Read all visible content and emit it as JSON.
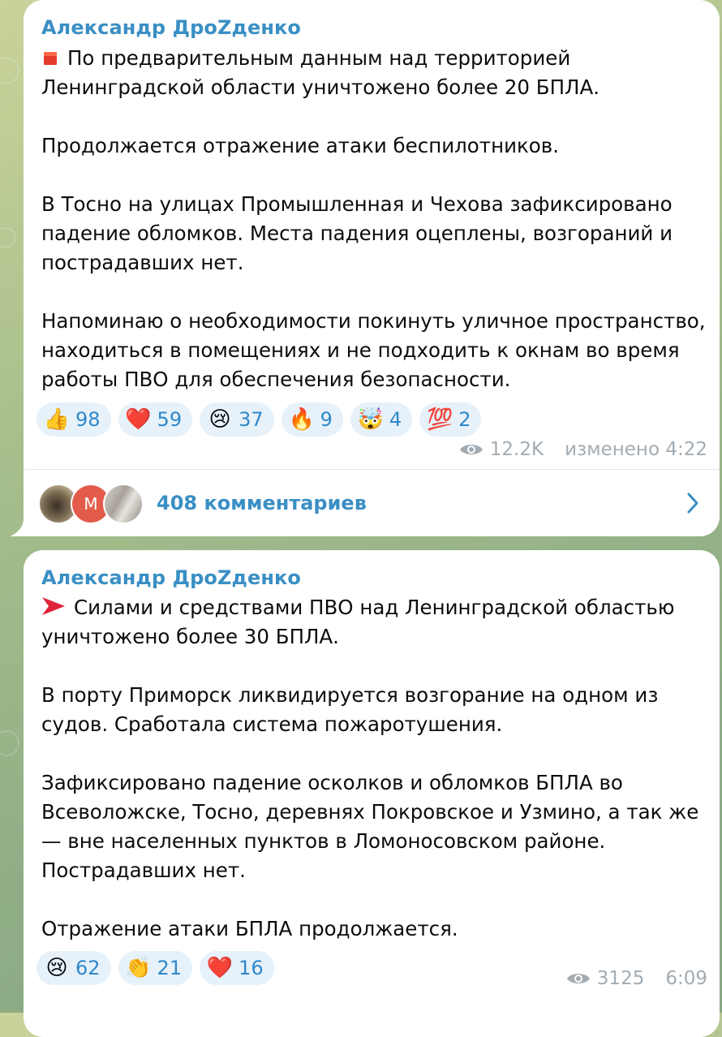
{
  "colors": {
    "link": "#3a8fc4",
    "reaction_bg": "#e6f1fa",
    "reaction_count": "#2f88c9",
    "meta": "#a3acb3",
    "text": "#0c0c0c"
  },
  "messages": [
    {
      "author": "Александр ДроZденко",
      "lead_icon": "red-square-icon",
      "paragraphs": [
        "По предварительным данным над территорией Ленинградской области уничтожено более 20 БПЛА.",
        "Продолжается отражение атаки беспилотников.",
        "В Тосно на улицах Промышленная и Чехова зафиксировано падение обломков. Места падения  оцеплены, возгораний и пострадавших нет.",
        "Напоминаю о необходимости покинуть уличное пространство, находиться в помещениях  и не подходить к окнам во время работы ПВО для обеспечения безопасности."
      ],
      "reactions": [
        {
          "emoji": "👍",
          "icon": "thumbs-up-icon",
          "count": "98"
        },
        {
          "emoji": "❤️",
          "icon": "red-heart-icon",
          "count": "59"
        },
        {
          "emoji": "😢",
          "icon": "crying-face-icon",
          "count": "37"
        },
        {
          "emoji": "🔥",
          "icon": "fire-icon",
          "count": "9"
        },
        {
          "emoji": "🤯",
          "icon": "exploding-head-icon",
          "count": "4"
        },
        {
          "emoji": "💯",
          "icon": "hundred-points-icon",
          "count": "2"
        }
      ],
      "views": "12.2K",
      "time": "изменено 4:22",
      "comments": {
        "label": "408 комментариев",
        "avatar_letter": "М"
      }
    },
    {
      "author": "Александр ДроZденко",
      "lead_icon": "red-arrow-icon",
      "paragraphs": [
        "Силами и средствами ПВО над Ленинградской областью уничтожено более 30 БПЛА.",
        "В порту Приморск ликвидируется возгорание на одном из судов. Сработала система пожаротушения.",
        "Зафиксировано падение осколков и обломков БПЛА во Всеволожске, Тосно, деревнях Покровское и Узмино, а так же — вне населенных пунктов в Ломоносовском районе. Пострадавших нет.",
        "Отражение атаки БПЛА продолжается."
      ],
      "reactions": [
        {
          "emoji": "😢",
          "icon": "crying-face-icon",
          "count": "62"
        },
        {
          "emoji": "👏",
          "icon": "clapping-hands-icon",
          "count": "21"
        },
        {
          "emoji": "❤️",
          "icon": "red-heart-icon",
          "count": "16"
        }
      ],
      "views": "3125",
      "time": "6:09"
    }
  ]
}
